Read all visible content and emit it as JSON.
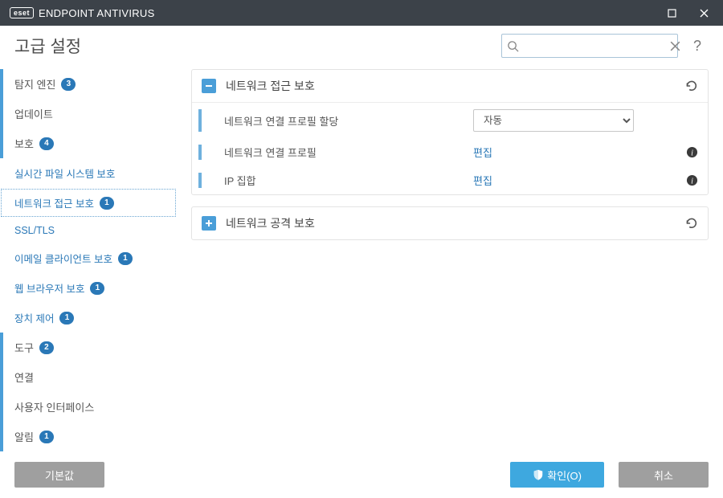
{
  "titlebar": {
    "brand_badge": "eset",
    "title": "ENDPOINT ANTIVIRUS"
  },
  "header": {
    "page_title": "고급 설정",
    "search_placeholder": ""
  },
  "sidebar": {
    "items": [
      {
        "label": "탐지 엔진",
        "badge": "3",
        "type": "top"
      },
      {
        "label": "업데이트",
        "type": "top"
      },
      {
        "label": "보호",
        "badge": "4",
        "type": "top"
      },
      {
        "label": "실시간 파일 시스템 보호",
        "type": "child"
      },
      {
        "label": "네트워크 접근 보호",
        "badge": "1",
        "type": "child",
        "selected": true
      },
      {
        "label": "SSL/TLS",
        "type": "child"
      },
      {
        "label": "이메일 클라이언트 보호",
        "badge": "1",
        "type": "child"
      },
      {
        "label": "웹 브라우저 보호",
        "badge": "1",
        "type": "child"
      },
      {
        "label": "장치 제어",
        "badge": "1",
        "type": "child"
      },
      {
        "label": "도구",
        "badge": "2",
        "type": "top"
      },
      {
        "label": "연결",
        "type": "top"
      },
      {
        "label": "사용자 인터페이스",
        "type": "top"
      },
      {
        "label": "알림",
        "badge": "1",
        "type": "top"
      }
    ]
  },
  "content": {
    "panel_access": {
      "title": "네트워크 접근 보호",
      "rows": {
        "profile_assign": {
          "label": "네트워크 연결 프로필 할당",
          "select_value": "자동"
        },
        "profile": {
          "label": "네트워크 연결 프로필",
          "link": "편집"
        },
        "ipset": {
          "label": "IP 집합",
          "link": "편집"
        }
      }
    },
    "panel_attack": {
      "title": "네트워크 공격 보호"
    }
  },
  "footer": {
    "defaults": "기본값",
    "ok": "확인(O)",
    "cancel": "취소"
  }
}
